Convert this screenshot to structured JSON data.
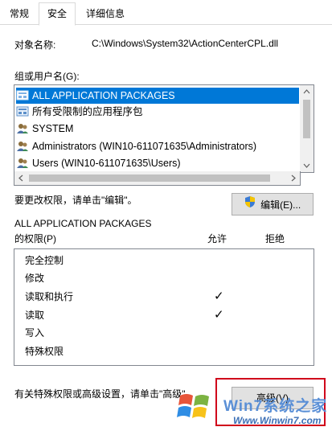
{
  "tabs": [
    {
      "label": "常规",
      "active": false
    },
    {
      "label": "安全",
      "active": true
    },
    {
      "label": "详细信息",
      "active": false
    }
  ],
  "object_name": {
    "label": "对象名称:",
    "value": "C:\\Windows\\System32\\ActionCenterCPL.dll"
  },
  "group_label": "组或用户名(G):",
  "principals": [
    {
      "name": "ALL APPLICATION PACKAGES",
      "icon": "app-package-icon",
      "selected": true
    },
    {
      "name": "所有受限制的应用程序包",
      "icon": "app-package-icon",
      "selected": false
    },
    {
      "name": "SYSTEM",
      "icon": "users-group-icon",
      "selected": false
    },
    {
      "name": "Administrators (WIN10-611071635\\Administrators)",
      "icon": "users-group-icon",
      "selected": false
    },
    {
      "name": "Users (WIN10-611071635\\Users)",
      "icon": "users-group-icon",
      "selected": false
    }
  ],
  "change_perm_text": "要更改权限，请单击\"编辑\"。",
  "edit_button": "编辑(E)...",
  "perm_for_title": "ALL APPLICATION PACKAGES",
  "perm_label": "的权限(P)",
  "col_allow": "允许",
  "col_deny": "拒绝",
  "permissions": [
    {
      "name": "完全控制",
      "allow": false,
      "deny": false
    },
    {
      "name": "修改",
      "allow": false,
      "deny": false
    },
    {
      "name": "读取和执行",
      "allow": true,
      "deny": false
    },
    {
      "name": "读取",
      "allow": true,
      "deny": false
    },
    {
      "name": "写入",
      "allow": false,
      "deny": false
    },
    {
      "name": "特殊权限",
      "allow": false,
      "deny": false
    }
  ],
  "check_glyph": "✓",
  "advanced_text": "有关特殊权限或高级设置，请单击\"高级\"。",
  "advanced_button": "高级(V)",
  "watermark": {
    "text": "Win7系统之家",
    "url": "Www.Winwin7.com"
  },
  "colors": {
    "selection": "#0078d7",
    "highlight_border": "#d0021b"
  }
}
